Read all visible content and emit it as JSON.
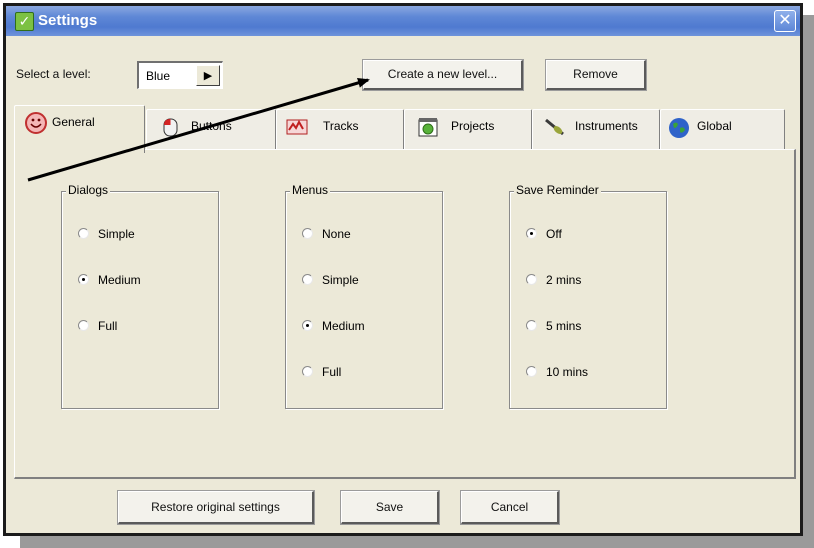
{
  "window": {
    "title": "Settings",
    "close_glyph": "✕"
  },
  "level": {
    "label": "Select a level:",
    "value": "Blue",
    "arrow_glyph": "▶"
  },
  "toolbar": {
    "create_label": "Create a new level...",
    "remove_label": "Remove"
  },
  "tabs": [
    {
      "label": "General",
      "icon": "smiley-icon",
      "active": true
    },
    {
      "label": "Buttons",
      "icon": "mouse-icon"
    },
    {
      "label": "Tracks",
      "icon": "tracks-icon"
    },
    {
      "label": "Projects",
      "icon": "projects-icon"
    },
    {
      "label": "Instruments",
      "icon": "instruments-icon"
    },
    {
      "label": "Global",
      "icon": "globe-icon"
    }
  ],
  "groups": {
    "dialogs": {
      "title": "Dialogs",
      "options": [
        "Simple",
        "Medium",
        "Full"
      ],
      "selected": "Medium"
    },
    "menus": {
      "title": "Menus",
      "options": [
        "None",
        "Simple",
        "Medium",
        "Full"
      ],
      "selected": "Medium"
    },
    "save_reminder": {
      "title": "Save Reminder",
      "options": [
        "Off",
        "2 mins",
        "5 mins",
        "10 mins"
      ],
      "selected": "Off"
    }
  },
  "footer": {
    "restore_label": "Restore original settings",
    "save_label": "Save",
    "cancel_label": "Cancel"
  },
  "colors": {
    "titlebar": "#5f88d6",
    "dialog_bg": "#ece9d8"
  }
}
